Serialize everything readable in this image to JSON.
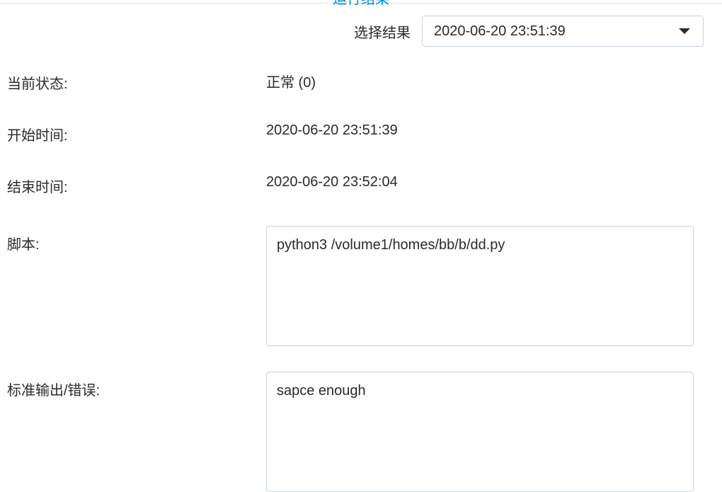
{
  "title": "运行结果",
  "selector": {
    "label": "选择结果",
    "selected": "2020-06-20 23:51:39"
  },
  "fields": {
    "status": {
      "label": "当前状态:",
      "value": "正常 (0)"
    },
    "start_time": {
      "label": "开始时间:",
      "value": "2020-06-20 23:51:39"
    },
    "end_time": {
      "label": "结束时间:",
      "value": "2020-06-20 23:52:04"
    },
    "script": {
      "label": "脚本:",
      "value": "python3 /volume1/homes/bb/b/dd.py"
    },
    "output": {
      "label": "标准输出/错误:",
      "value": "sapce enough"
    }
  }
}
